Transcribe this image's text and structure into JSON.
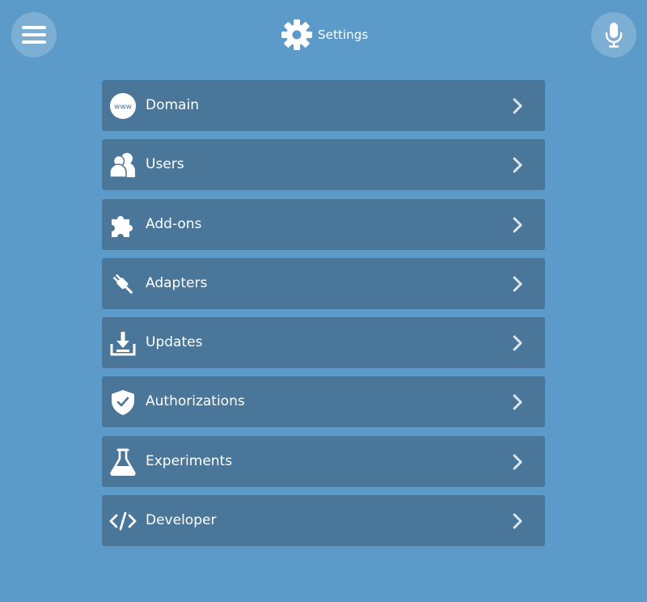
{
  "header": {
    "title": "Settings",
    "menu_icon": "hamburger-menu-icon",
    "title_icon": "gear-icon",
    "mic_icon": "microphone-icon"
  },
  "settings": {
    "items": [
      {
        "label": "Domain",
        "icon": "www-globe-icon"
      },
      {
        "label": "Users",
        "icon": "users-icon"
      },
      {
        "label": "Add-ons",
        "icon": "puzzle-piece-icon"
      },
      {
        "label": "Adapters",
        "icon": "plug-icon"
      },
      {
        "label": "Updates",
        "icon": "download-tray-icon"
      },
      {
        "label": "Authorizations",
        "icon": "shield-check-icon"
      },
      {
        "label": "Experiments",
        "icon": "flask-icon"
      },
      {
        "label": "Developer",
        "icon": "code-icon"
      }
    ]
  },
  "www_icon_text": "www",
  "colors": {
    "background": "#5c9bc9",
    "item_background": "#4a7799",
    "text": "#ffffff"
  }
}
